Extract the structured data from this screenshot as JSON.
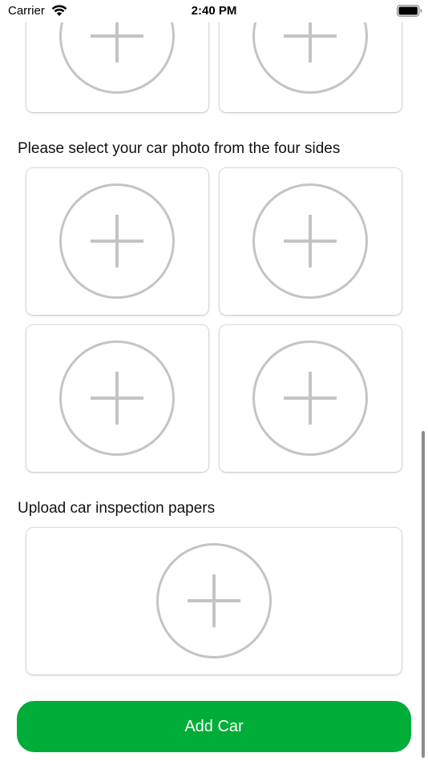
{
  "status_bar": {
    "carrier": "Carrier",
    "time": "2:40 PM"
  },
  "sections": {
    "four_sides_label": "Please select your car photo from the four sides",
    "inspection_label": "Upload car inspection papers"
  },
  "actions": {
    "add_car_label": "Add Car"
  },
  "colors": {
    "accent_green": "#00AD38",
    "plus_gray": "#C4C4C4"
  },
  "icons": {
    "photo_slot": "plus-circle-icon"
  }
}
